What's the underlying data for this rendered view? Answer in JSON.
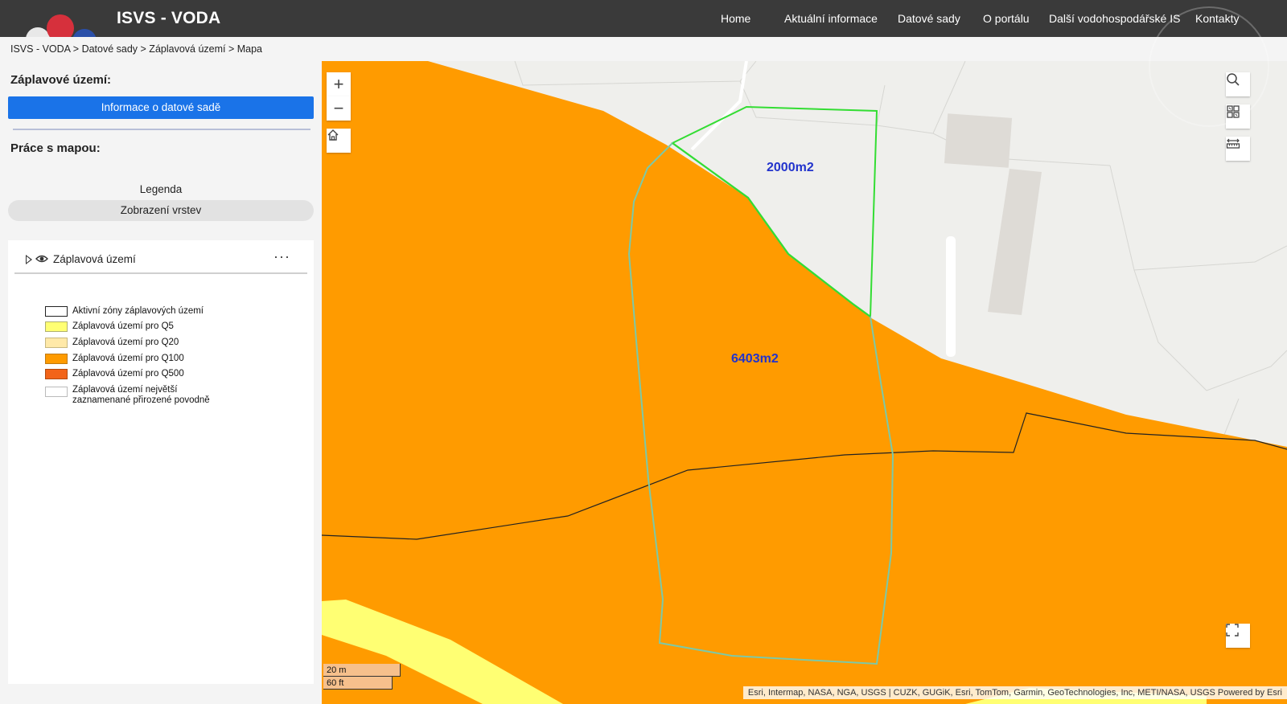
{
  "header": {
    "brand": "ISVS - VODA",
    "nav": [
      "Home",
      "Aktuální informace",
      "Datové sady",
      "O portálu",
      "Další vodohospodářské IS",
      "Kontakty"
    ]
  },
  "breadcrumb": "ISVS - VODA > Datové sady > Záplavová území > Mapa",
  "sidebar": {
    "title": "Záplavové území:",
    "info_button": "Informace o datové sadě",
    "map_work_title": "Práce s mapou:",
    "legend_button": "Legenda",
    "layers_button": "Zobrazení vrstev",
    "layer_name": "Záplavová území",
    "more_label": "···",
    "legend_items": [
      {
        "label": "Aktivní zóny záplavových území",
        "color": "#ffffff",
        "border": "#222222"
      },
      {
        "label": "Záplavová území pro Q5",
        "color": "#ffff73",
        "border": "#b0b070"
      },
      {
        "label": "Záplavová území pro Q20",
        "color": "#ffe9a8",
        "border": "#c8b880"
      },
      {
        "label": "Záplavová území pro Q100",
        "color": "#ff9b00",
        "border": "#c07a10"
      },
      {
        "label": "Záplavová území pro Q500",
        "color": "#f26419",
        "border": "#b04a10"
      },
      {
        "label": "Záplavová území největší zaznamenané přirozené povodně",
        "color": "#ffffff",
        "border": "#bbbbbb"
      }
    ]
  },
  "map": {
    "zoom_in": "+",
    "zoom_out": "−",
    "area_labels": [
      "2000m2",
      "6403m2"
    ],
    "scale_metric": "20 m",
    "scale_imperial": "60 ft",
    "attribution": "Esri, Intermap, NASA, NGA, USGS | CUZK, GUGiK, Esri, TomTom, Garmin, GeoTechnologies, Inc, METI/NASA, USGS   Powered by Esri",
    "colors": {
      "q100": "#ff9b00",
      "q5": "#ffff73",
      "basemap": "#efefec",
      "parcel_green": "#33dd33",
      "parcel_teal": "#66ccaa"
    }
  }
}
